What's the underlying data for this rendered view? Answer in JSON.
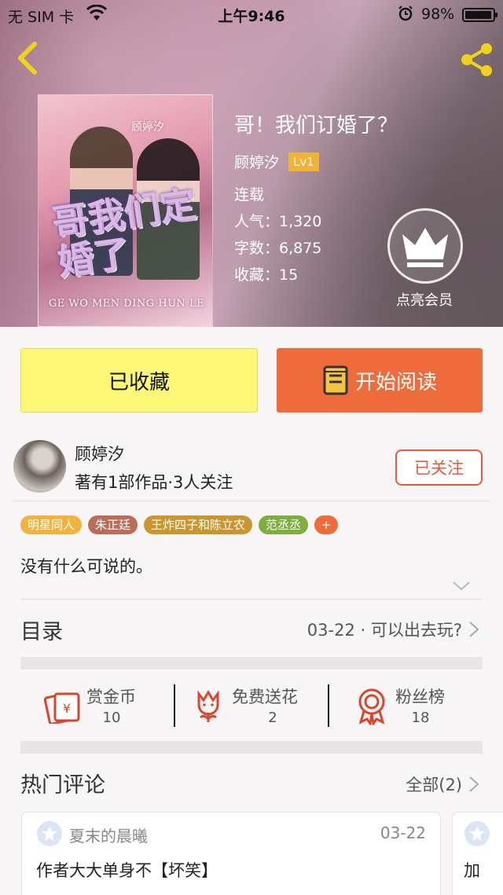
{
  "status_bar": {
    "carrier": "无 SIM 卡",
    "time": "上午9:46",
    "battery": "98%"
  },
  "book": {
    "cover_author": "顾婷汐",
    "cover_title": "哥我们定婚了",
    "cover_pinyin": "GE WO MEN DING HUN LE",
    "title": "哥！我们订婚了？",
    "author": "顾婷汐",
    "level": "Lv1",
    "status": "连载",
    "popularity": "人气：1,320",
    "word_count": "字数：6,875",
    "favorites": "收藏：15",
    "vip_label": "点亮会员"
  },
  "buttons": {
    "favorite_label": "已收藏",
    "read_label": "开始阅读"
  },
  "author_card": {
    "name": "顾婷汐",
    "stats": "著有1部作品·3人关注",
    "follow_label": "已关注"
  },
  "tags": [
    {
      "label": "明星同人",
      "color": "#f0b33e"
    },
    {
      "label": "朱正廷",
      "color": "#b96e5c"
    },
    {
      "label": "王炸四子和陈立农",
      "color": "#c9962f"
    },
    {
      "label": "范丞丞",
      "color": "#7fae3e"
    },
    {
      "label": "+",
      "color": "#ee6c3b"
    }
  ],
  "description": "没有什么可说的。",
  "toc": {
    "label": "目录",
    "latest": "03-22 · 可以出去玩?"
  },
  "actions": [
    {
      "label": "赏金币",
      "count": "10",
      "icon": "red-envelope-icon"
    },
    {
      "label": "免费送花",
      "count": "2",
      "icon": "flower-icon"
    },
    {
      "label": "粉丝榜",
      "count": "18",
      "icon": "medal-icon"
    }
  ],
  "hot_comments": {
    "title": "热门评论",
    "all_label": "全部(2)",
    "comments": [
      {
        "user": "夏末的晨曦",
        "date": "03-22",
        "text": "作者大大单身不【坏笑】"
      },
      {
        "text": "加"
      }
    ]
  },
  "colors": {
    "accent_orange": "#ee6c3b",
    "favorite_yellow": "#fdf777",
    "follow_red": "#e65a3d",
    "level_badge": "#f2b233"
  }
}
